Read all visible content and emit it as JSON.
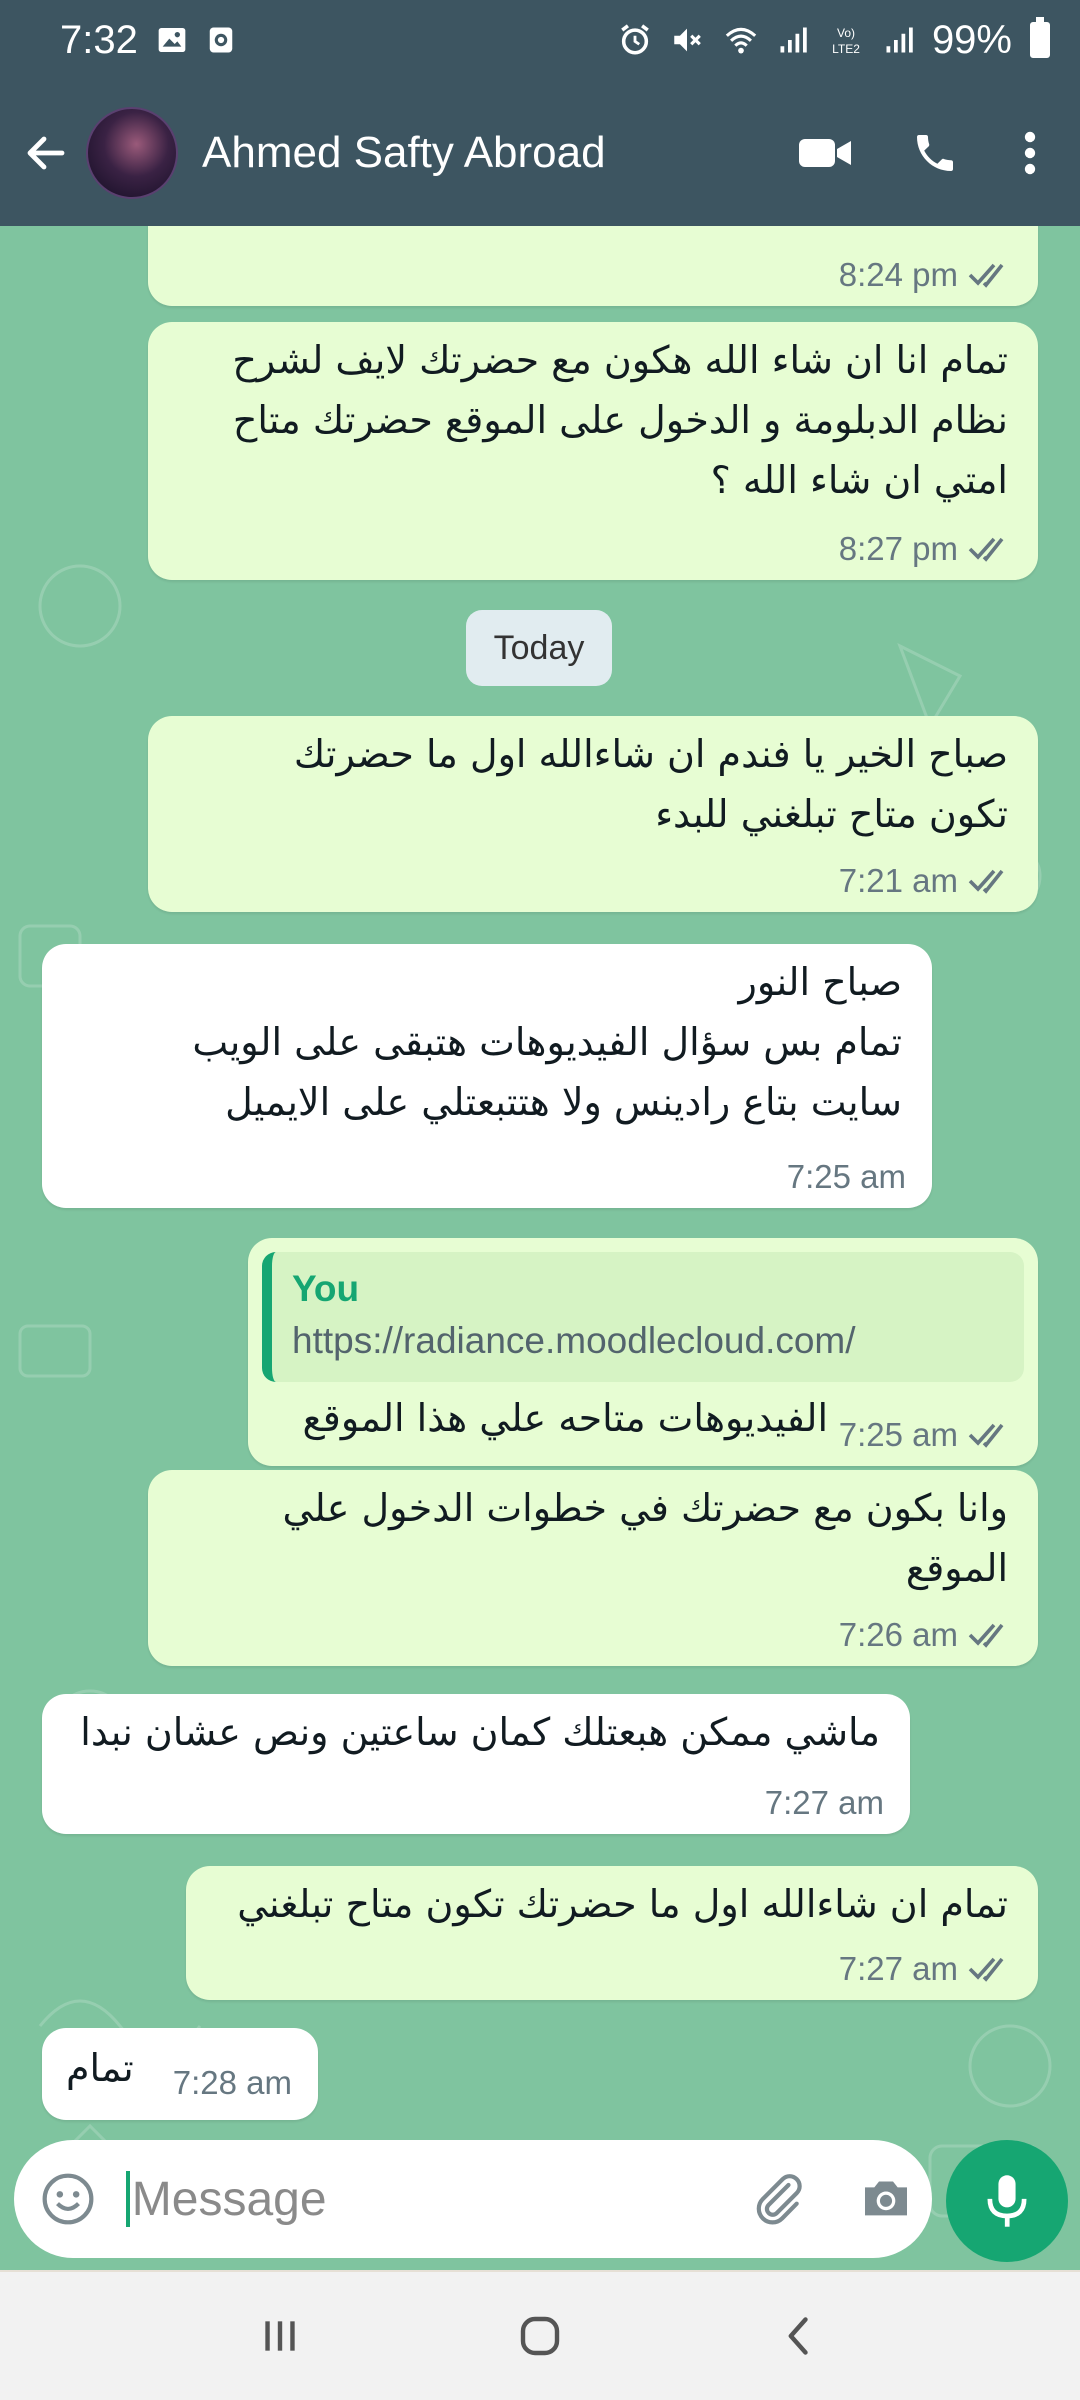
{
  "status_bar": {
    "time": "7:32",
    "battery": "99%",
    "left_icons": [
      "image-icon",
      "record-icon"
    ],
    "right_icons": [
      "alarm-icon",
      "mute-icon",
      "wifi-icon",
      "signal-icon",
      "volte-icon",
      "signal-icon",
      "battery-icon"
    ]
  },
  "header": {
    "contact_name": "Ahmed Safty Abroad",
    "icons": [
      "back-arrow-icon",
      "video-call-icon",
      "voice-call-icon",
      "more-options-icon"
    ]
  },
  "chat": {
    "date_chip": "Today",
    "messages": [
      {
        "direction": "out",
        "text": "",
        "time": "8:24 pm",
        "read": true
      },
      {
        "direction": "out",
        "text": "تمام انا ان شاء الله هكون مع حضرتك لايف لشرح نظام الدبلومة و الدخول على الموقع حضرتك متاح امتي ان شاء الله ؟",
        "lines": [
          "تمام انا ان شاء الله هكون مع حضرتك لايف لشرح",
          "نظام الدبلومة و الدخول على الموقع حضرتك متاح",
          "امتي ان شاء الله ؟"
        ],
        "time": "8:27 pm",
        "read": true
      },
      {
        "direction": "out",
        "lines": [
          "صباح الخير يا فندم ان شاءالله اول ما حضرتك",
          "تكون متاح تبلغني للبدء"
        ],
        "time": "7:21 am",
        "read": true
      },
      {
        "direction": "in",
        "lines": [
          "صباح النور",
          "تمام بس سؤال الفيديوهات هتبقى على الويب",
          "سايت بتاع رادينس ولا هتتبعتلي على الايميل"
        ],
        "time": "7:25 am"
      },
      {
        "direction": "out",
        "quote_author": "You",
        "quote_text": "https://radiance.moodlecloud.com/",
        "lines": [
          "الفيديوهات متاحه علي هذا الموقع"
        ],
        "time": "7:25 am",
        "read": true
      },
      {
        "direction": "out",
        "lines": [
          "وانا بكون مع حضرتك في خطوات الدخول علي",
          "الموقع"
        ],
        "time": "7:26 am",
        "read": true
      },
      {
        "direction": "in",
        "lines": [
          "ماشي ممكن هبعتلك كمان ساعتين ونص عشان نبدا"
        ],
        "time": "7:27 am"
      },
      {
        "direction": "out",
        "lines": [
          "تمام ان شاءالله اول ما حضرتك تكون متاح تبلغني"
        ],
        "time": "7:27 am",
        "read": true
      },
      {
        "direction": "in",
        "lines": [
          "تمام"
        ],
        "time": "7:28 am"
      }
    ]
  },
  "composer": {
    "placeholder": "Message",
    "icons": [
      "emoji-icon",
      "attach-icon",
      "camera-icon",
      "mic-icon"
    ]
  },
  "nav": {
    "icons": [
      "recents-icon",
      "home-icon",
      "back-icon"
    ]
  },
  "colors": {
    "header": "#3d5561",
    "chat_bg": "#7fc49f",
    "outgoing": "#e7fdd3",
    "incoming": "#ffffff",
    "accent": "#16a672",
    "read_ticks": "#667781"
  }
}
